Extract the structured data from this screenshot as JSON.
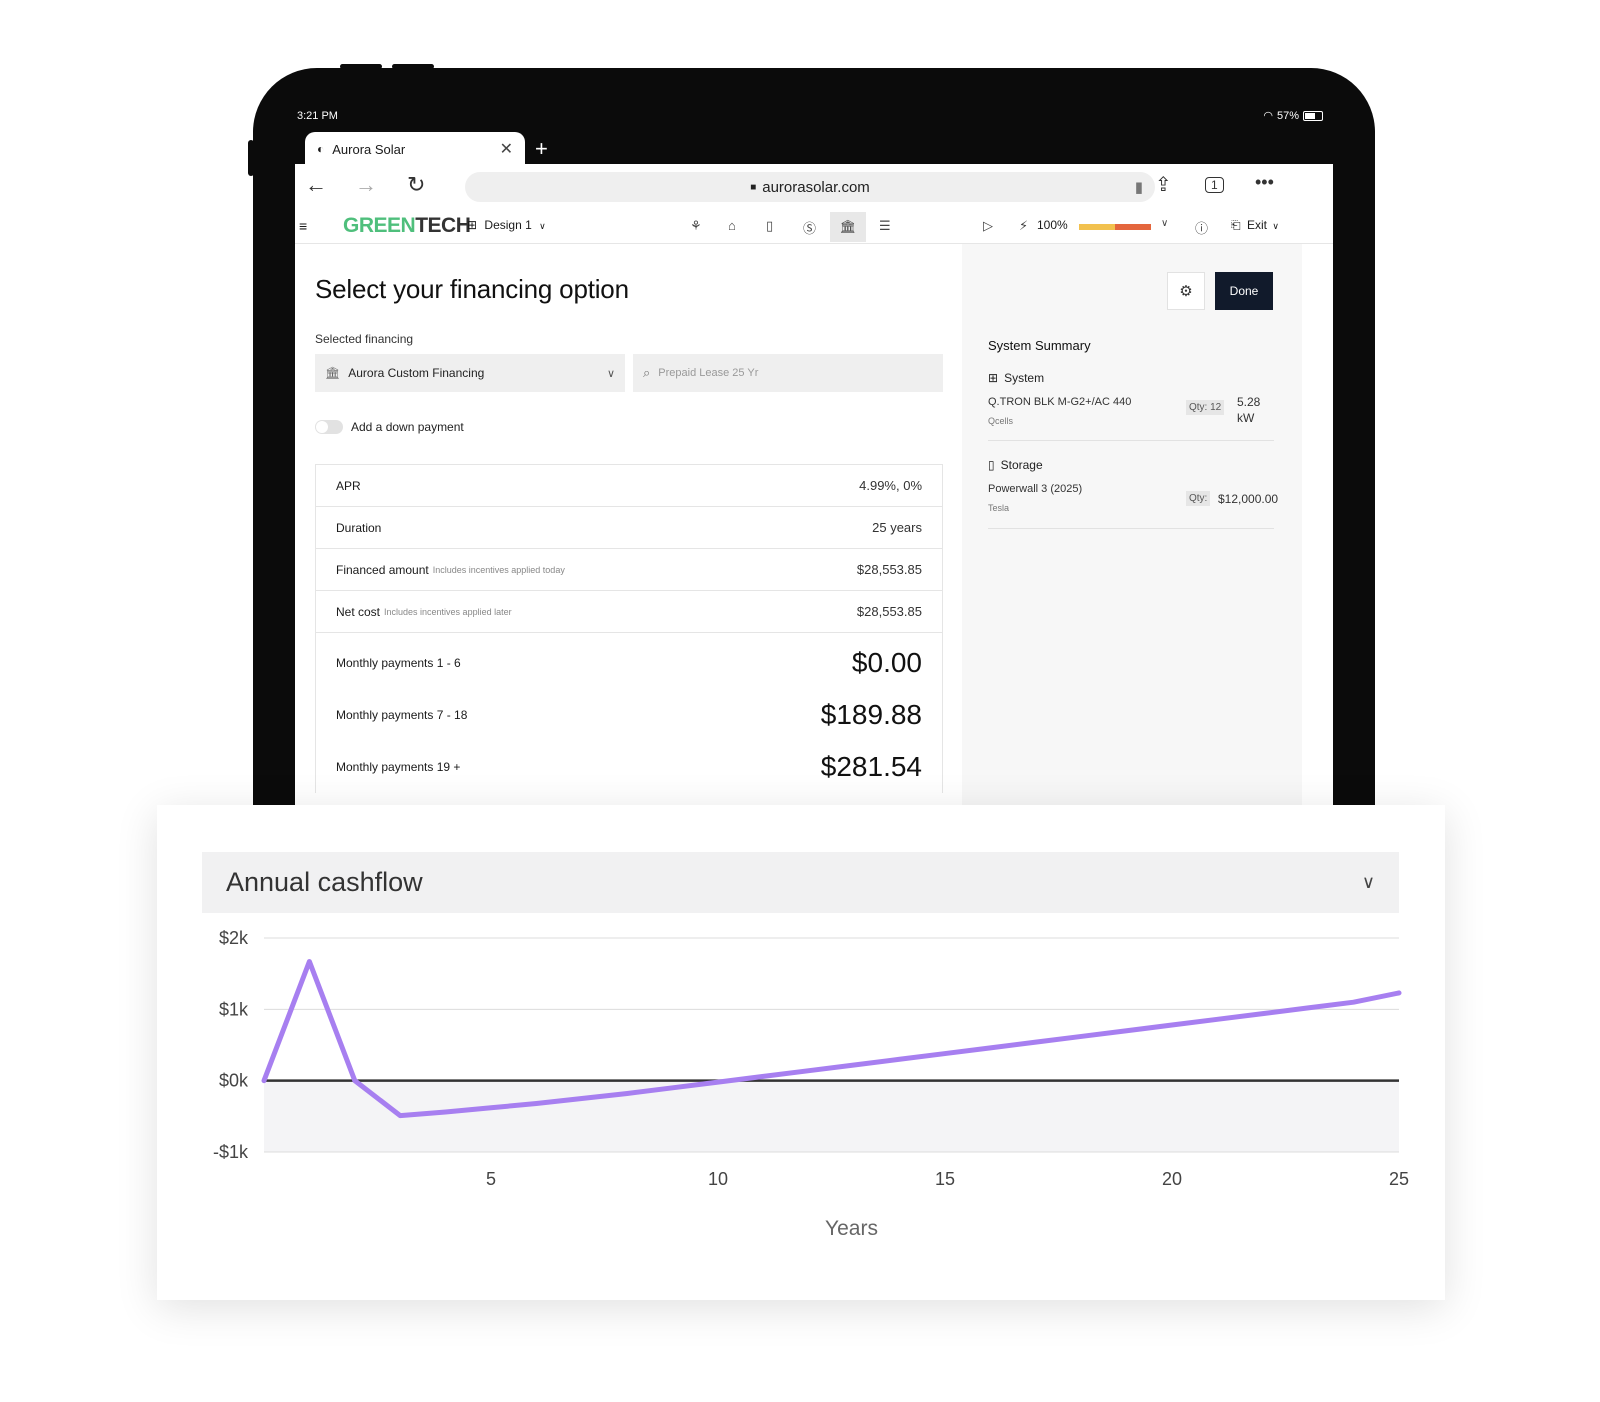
{
  "status": {
    "time": "3:21 PM",
    "battery": "57%"
  },
  "browser": {
    "tab_title": "Aurora Solar",
    "url": "aurorasolar.com"
  },
  "app": {
    "logo_green": "GREEN",
    "logo_dark": "TECH",
    "design_label": "Design 1",
    "zoom": "100%",
    "exit_label": "Exit",
    "progress_fraction": 0.5
  },
  "financing": {
    "title": "Select your financing option",
    "selected_label": "Selected financing",
    "selected_value": "Aurora Custom Financing",
    "search_placeholder": "Prepaid Lease 25 Yr",
    "down_payment_label": "Add a down payment",
    "rows": [
      {
        "label": "APR",
        "hint": "",
        "value": "4.99%, 0%"
      },
      {
        "label": "Duration",
        "hint": "",
        "value": "25 years"
      },
      {
        "label": "Financed amount",
        "hint": "Includes incentives applied today",
        "value": "$28,553.85"
      },
      {
        "label": "Net cost",
        "hint": "Includes incentives applied later",
        "value": "$28,553.85"
      }
    ],
    "payments": [
      {
        "label": "Monthly payments 1 - 6",
        "value": "$0.00"
      },
      {
        "label": "Monthly payments 7 - 18",
        "value": "$189.88"
      },
      {
        "label": "Monthly payments 19 +",
        "value": "$281.54"
      }
    ]
  },
  "summary": {
    "done_label": "Done",
    "title": "System Summary",
    "system_label": "System",
    "system_item": "Q.TRON BLK M-G2+/AC 440",
    "system_maker": "Qcells",
    "system_qty": "Qty: 12",
    "system_value_1": "5.28",
    "system_value_2": "kW",
    "storage_label": "Storage",
    "storage_item": "Powerwall 3 (2025)",
    "storage_maker": "Tesla",
    "storage_qty": "Qty:",
    "storage_value": "$12,000.00"
  },
  "cashflow": {
    "title": "Annual cashflow"
  },
  "chart_data": {
    "type": "line",
    "title": "Annual cashflow",
    "xlabel": "Years",
    "ylabel": "",
    "xlim": [
      0,
      25
    ],
    "ylim": [
      -1000,
      2000
    ],
    "xticks": [
      5,
      10,
      15,
      20,
      25
    ],
    "yticks": [
      {
        "v": 2000,
        "label": "$2k"
      },
      {
        "v": 1000,
        "label": "$1k"
      },
      {
        "v": 0,
        "label": "$0k"
      },
      {
        "v": -1000,
        "label": "-$1k"
      }
    ],
    "grid": true,
    "series": [
      {
        "name": "",
        "color": "#a77ff0",
        "x": [
          0,
          1,
          2,
          3,
          4,
          5,
          6,
          7,
          8,
          9,
          10,
          11,
          12,
          13,
          14,
          15,
          16,
          17,
          18,
          19,
          20,
          21,
          22,
          23,
          24,
          25
        ],
        "y": [
          0,
          1670,
          0,
          -490,
          -440,
          -380,
          -320,
          -250,
          -180,
          -100,
          -20,
          60,
          140,
          220,
          300,
          380,
          460,
          540,
          620,
          700,
          780,
          860,
          940,
          1020,
          1100,
          1230
        ]
      }
    ]
  }
}
